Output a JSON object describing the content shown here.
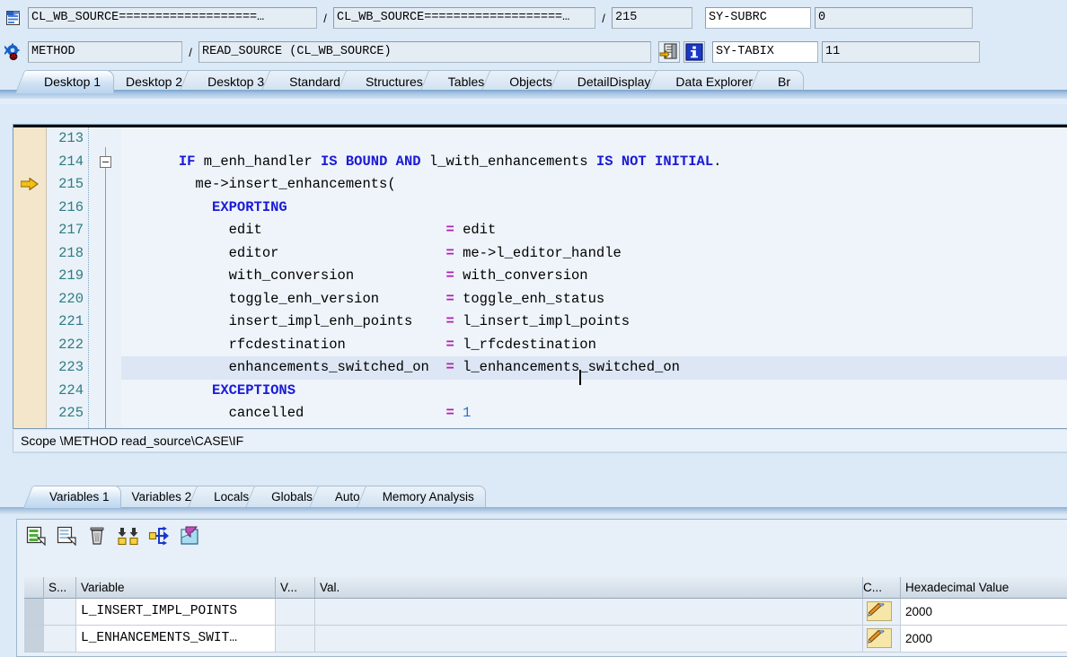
{
  "header": {
    "program_icon": "program-document-icon",
    "debug_icon": "gear-bug-icon",
    "row1": {
      "main_program": "CL_WB_SOURCE===================…",
      "include": "CL_WB_SOURCE===================…",
      "line": "215",
      "subrc_label": "SY-SUBRC",
      "subrc_value": "0",
      "sep": "/"
    },
    "row2": {
      "event_type": "METHOD",
      "event_name": "READ_SOURCE (CL_WB_SOURCE)",
      "goto_icon": "goto-source-icon",
      "info_icon": "info-icon",
      "tabix_label": "SY-TABIX",
      "tabix_value": "11",
      "sep": "/"
    }
  },
  "main_tabs": [
    {
      "label": "Desktop 1",
      "active": true
    },
    {
      "label": "Desktop 2",
      "active": false
    },
    {
      "label": "Desktop 3",
      "active": false
    },
    {
      "label": "Standard",
      "active": false
    },
    {
      "label": "Structures",
      "active": false
    },
    {
      "label": "Tables",
      "active": false
    },
    {
      "label": "Objects",
      "active": false
    },
    {
      "label": "DetailDisplay",
      "active": false
    },
    {
      "label": "Data Explorer",
      "active": false
    },
    {
      "label": "Br",
      "active": false
    }
  ],
  "code": {
    "current_line": "215",
    "lines": [
      {
        "no": "213",
        "html": ""
      },
      {
        "no": "214",
        "html": "      <span class=\"kw\">IF</span> m_enh_handler <span class=\"kw\">IS BOUND AND</span> l_with_enhancements <span class=\"kw\">IS NOT INITIAL</span>."
      },
      {
        "no": "215",
        "html": "        me-&gt;insert_enhancements("
      },
      {
        "no": "216",
        "html": "          <span class=\"kw\">EXPORTING</span>"
      },
      {
        "no": "217",
        "html": "            edit                      <span class=\"eq\">=</span> edit"
      },
      {
        "no": "218",
        "html": "            editor                    <span class=\"eq\">=</span> me-&gt;l_editor_handle"
      },
      {
        "no": "219",
        "html": "            with_conversion           <span class=\"eq\">=</span> with_conversion"
      },
      {
        "no": "220",
        "html": "            toggle_enh_version        <span class=\"eq\">=</span> toggle_enh_status"
      },
      {
        "no": "221",
        "html": "            insert_impl_enh_points    <span class=\"eq\">=</span> l_insert_impl_points"
      },
      {
        "no": "222",
        "html": "            rfcdestination            <span class=\"eq\">=</span> l_rfcdestination"
      },
      {
        "no": "223",
        "html": "            enhancements_switched_on  <span class=\"eq\">=</span> l_enhancements_switched_on",
        "highlight": true
      },
      {
        "no": "224",
        "html": "          <span class=\"kw\">EXCEPTIONS</span>"
      },
      {
        "no": "225",
        "html": "            cancelled                 <span class=\"eq\">=</span> <span class=\"num\">1</span>"
      }
    ]
  },
  "scope": {
    "text": "Scope \\METHOD read_source\\CASE\\IF"
  },
  "lower_tabs": [
    {
      "label": "Variables 1",
      "active": true
    },
    {
      "label": "Variables 2",
      "active": false
    },
    {
      "label": "Locals",
      "active": false
    },
    {
      "label": "Globals",
      "active": false
    },
    {
      "label": "Auto",
      "active": false
    },
    {
      "label": "Memory Analysis",
      "active": false
    }
  ],
  "var_toolbar": [
    {
      "name": "insert-row-icon"
    },
    {
      "name": "copy-row-icon"
    },
    {
      "name": "delete-row-icon"
    },
    {
      "name": "collapse-all-icon"
    },
    {
      "name": "expand-node-icon"
    },
    {
      "name": "filter-icon"
    }
  ],
  "var_table": {
    "columns": [
      "",
      "S...",
      "Variable",
      "V...",
      "Val.",
      "C...",
      "Hexadecimal Value"
    ],
    "rows": [
      {
        "sel": "",
        "s": "",
        "variable": "L_INSERT_IMPL_POINTS",
        "v": "",
        "val": "",
        "c_icon": "pencil-edit-icon",
        "hex": "2000"
      },
      {
        "sel": "",
        "s": "",
        "variable": "L_ENHANCEMENTS_SWIT…",
        "v": "",
        "val": "",
        "c_icon": "pencil-edit-icon",
        "hex": "2000"
      }
    ]
  },
  "colors": {
    "background": "#dce9f6",
    "keyword": "#1a1ad6",
    "line_number": "#2d7d84",
    "operator": "#b020b0",
    "breakpoint_gutter": "#f3e6cb",
    "arrow": "#f0b400"
  }
}
